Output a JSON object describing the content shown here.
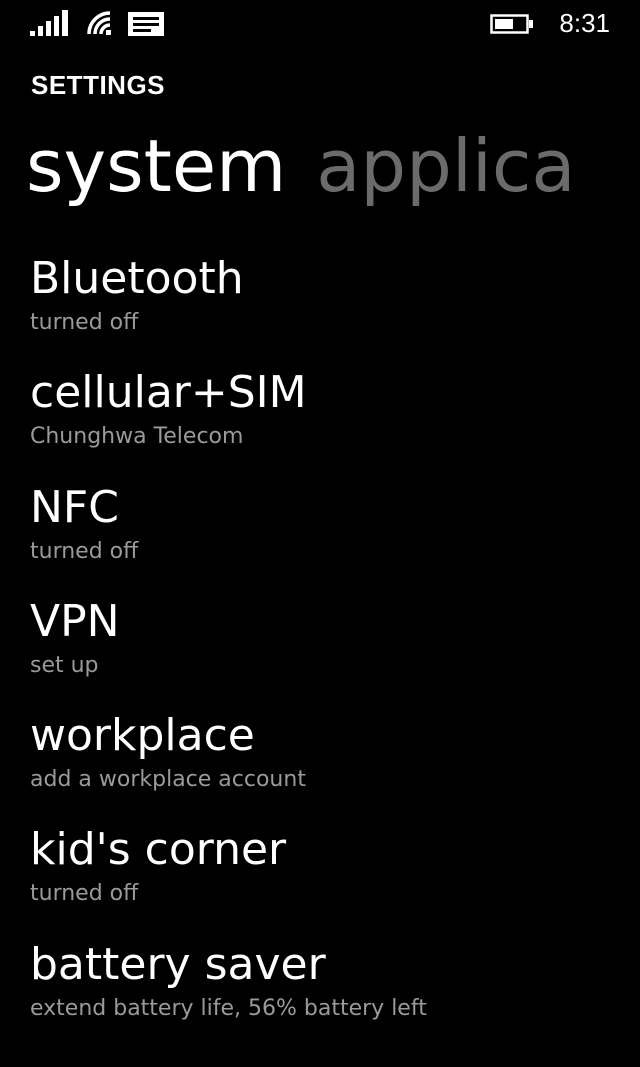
{
  "status_bar": {
    "time": "8:31",
    "icons": [
      "signal-strength-icon",
      "wifi-icon",
      "message-icon",
      "battery-icon"
    ]
  },
  "header": {
    "app_title": "SETTINGS",
    "tabs": [
      {
        "label": "system",
        "active": true
      },
      {
        "label": "applica",
        "active": false
      }
    ]
  },
  "settings": {
    "items": [
      {
        "title": "Bluetooth",
        "subtitle": "turned off"
      },
      {
        "title": "cellular+SIM",
        "subtitle": "Chunghwa Telecom"
      },
      {
        "title": "NFC",
        "subtitle": "turned off"
      },
      {
        "title": "VPN",
        "subtitle": "set up"
      },
      {
        "title": "workplace",
        "subtitle": "add a workplace account"
      },
      {
        "title": "kid's corner",
        "subtitle": "turned off"
      },
      {
        "title": "battery saver",
        "subtitle": "extend battery life, 56% battery left"
      }
    ]
  },
  "colors": {
    "background": "#000000",
    "text_primary": "#ffffff",
    "text_secondary": "#9a9a9a",
    "tab_inactive": "#6b6b6b"
  }
}
